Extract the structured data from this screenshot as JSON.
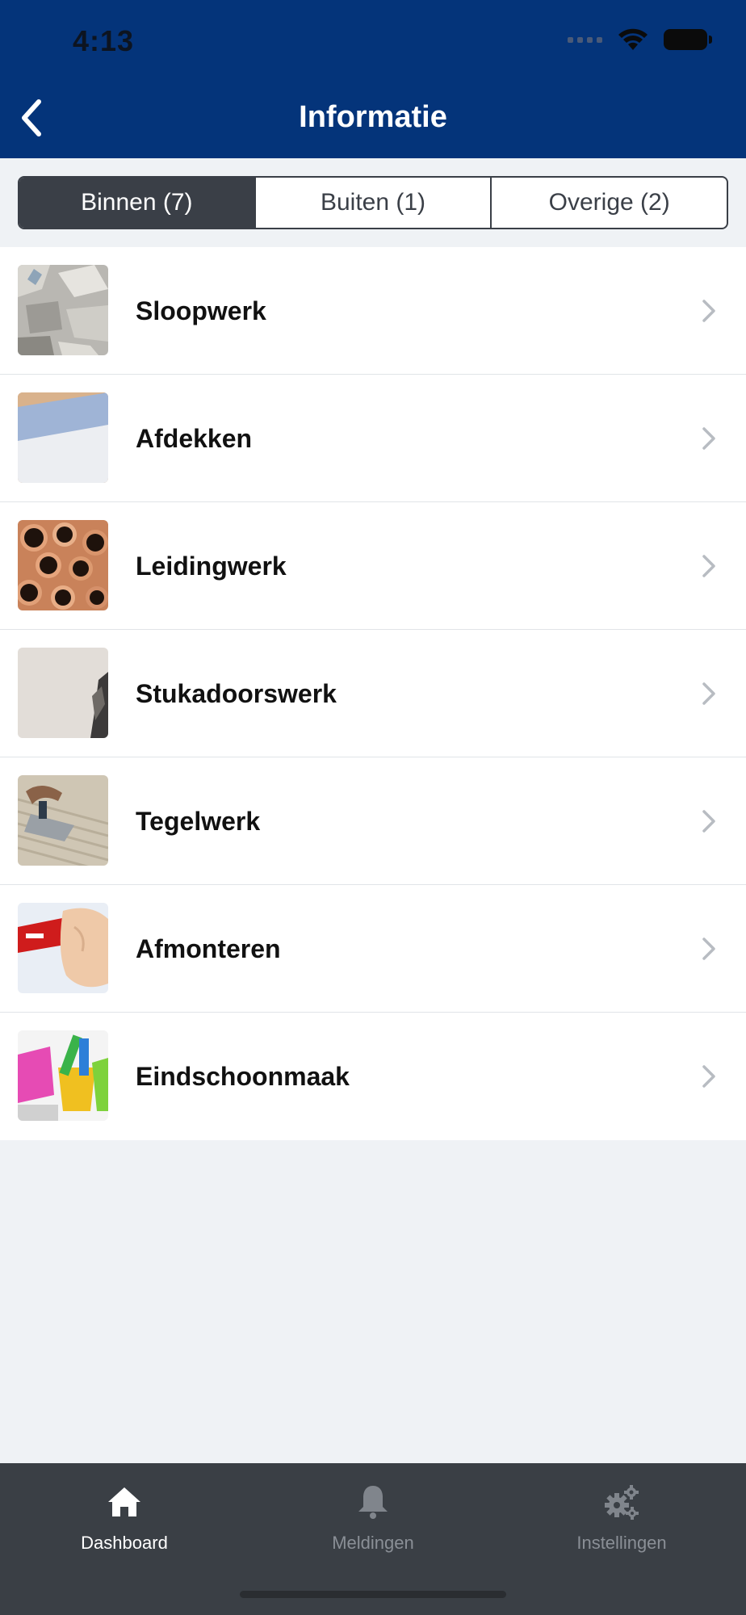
{
  "status_bar": {
    "time": "4:13"
  },
  "header": {
    "title": "Informatie",
    "back_icon": "chevron-left-icon"
  },
  "segments": [
    {
      "label": "Binnen (7)",
      "active": true
    },
    {
      "label": "Buiten (1)",
      "active": false
    },
    {
      "label": "Overige (2)",
      "active": false
    }
  ],
  "items": [
    {
      "label": "Sloopwerk",
      "thumb": "rubble-photo"
    },
    {
      "label": "Afdekken",
      "thumb": "cover-roll-photo"
    },
    {
      "label": "Leidingwerk",
      "thumb": "copper-pipes-photo"
    },
    {
      "label": "Stukadoorswerk",
      "thumb": "plaster-wall-photo"
    },
    {
      "label": "Tegelwerk",
      "thumb": "tile-trowel-photo"
    },
    {
      "label": "Afmonteren",
      "thumb": "installation-photo"
    },
    {
      "label": "Eindschoonmaak",
      "thumb": "cleaning-bucket-photo"
    }
  ],
  "tabbar": [
    {
      "label": "Dashboard",
      "icon": "home-icon",
      "active": true
    },
    {
      "label": "Meldingen",
      "icon": "bell-icon",
      "active": false
    },
    {
      "label": "Instellingen",
      "icon": "gears-icon",
      "active": false
    }
  ],
  "colors": {
    "header_bg": "#04347a",
    "segment_active": "#3a3f47",
    "tabbar_bg": "#3a3f45",
    "page_bg": "#eff2f5"
  }
}
